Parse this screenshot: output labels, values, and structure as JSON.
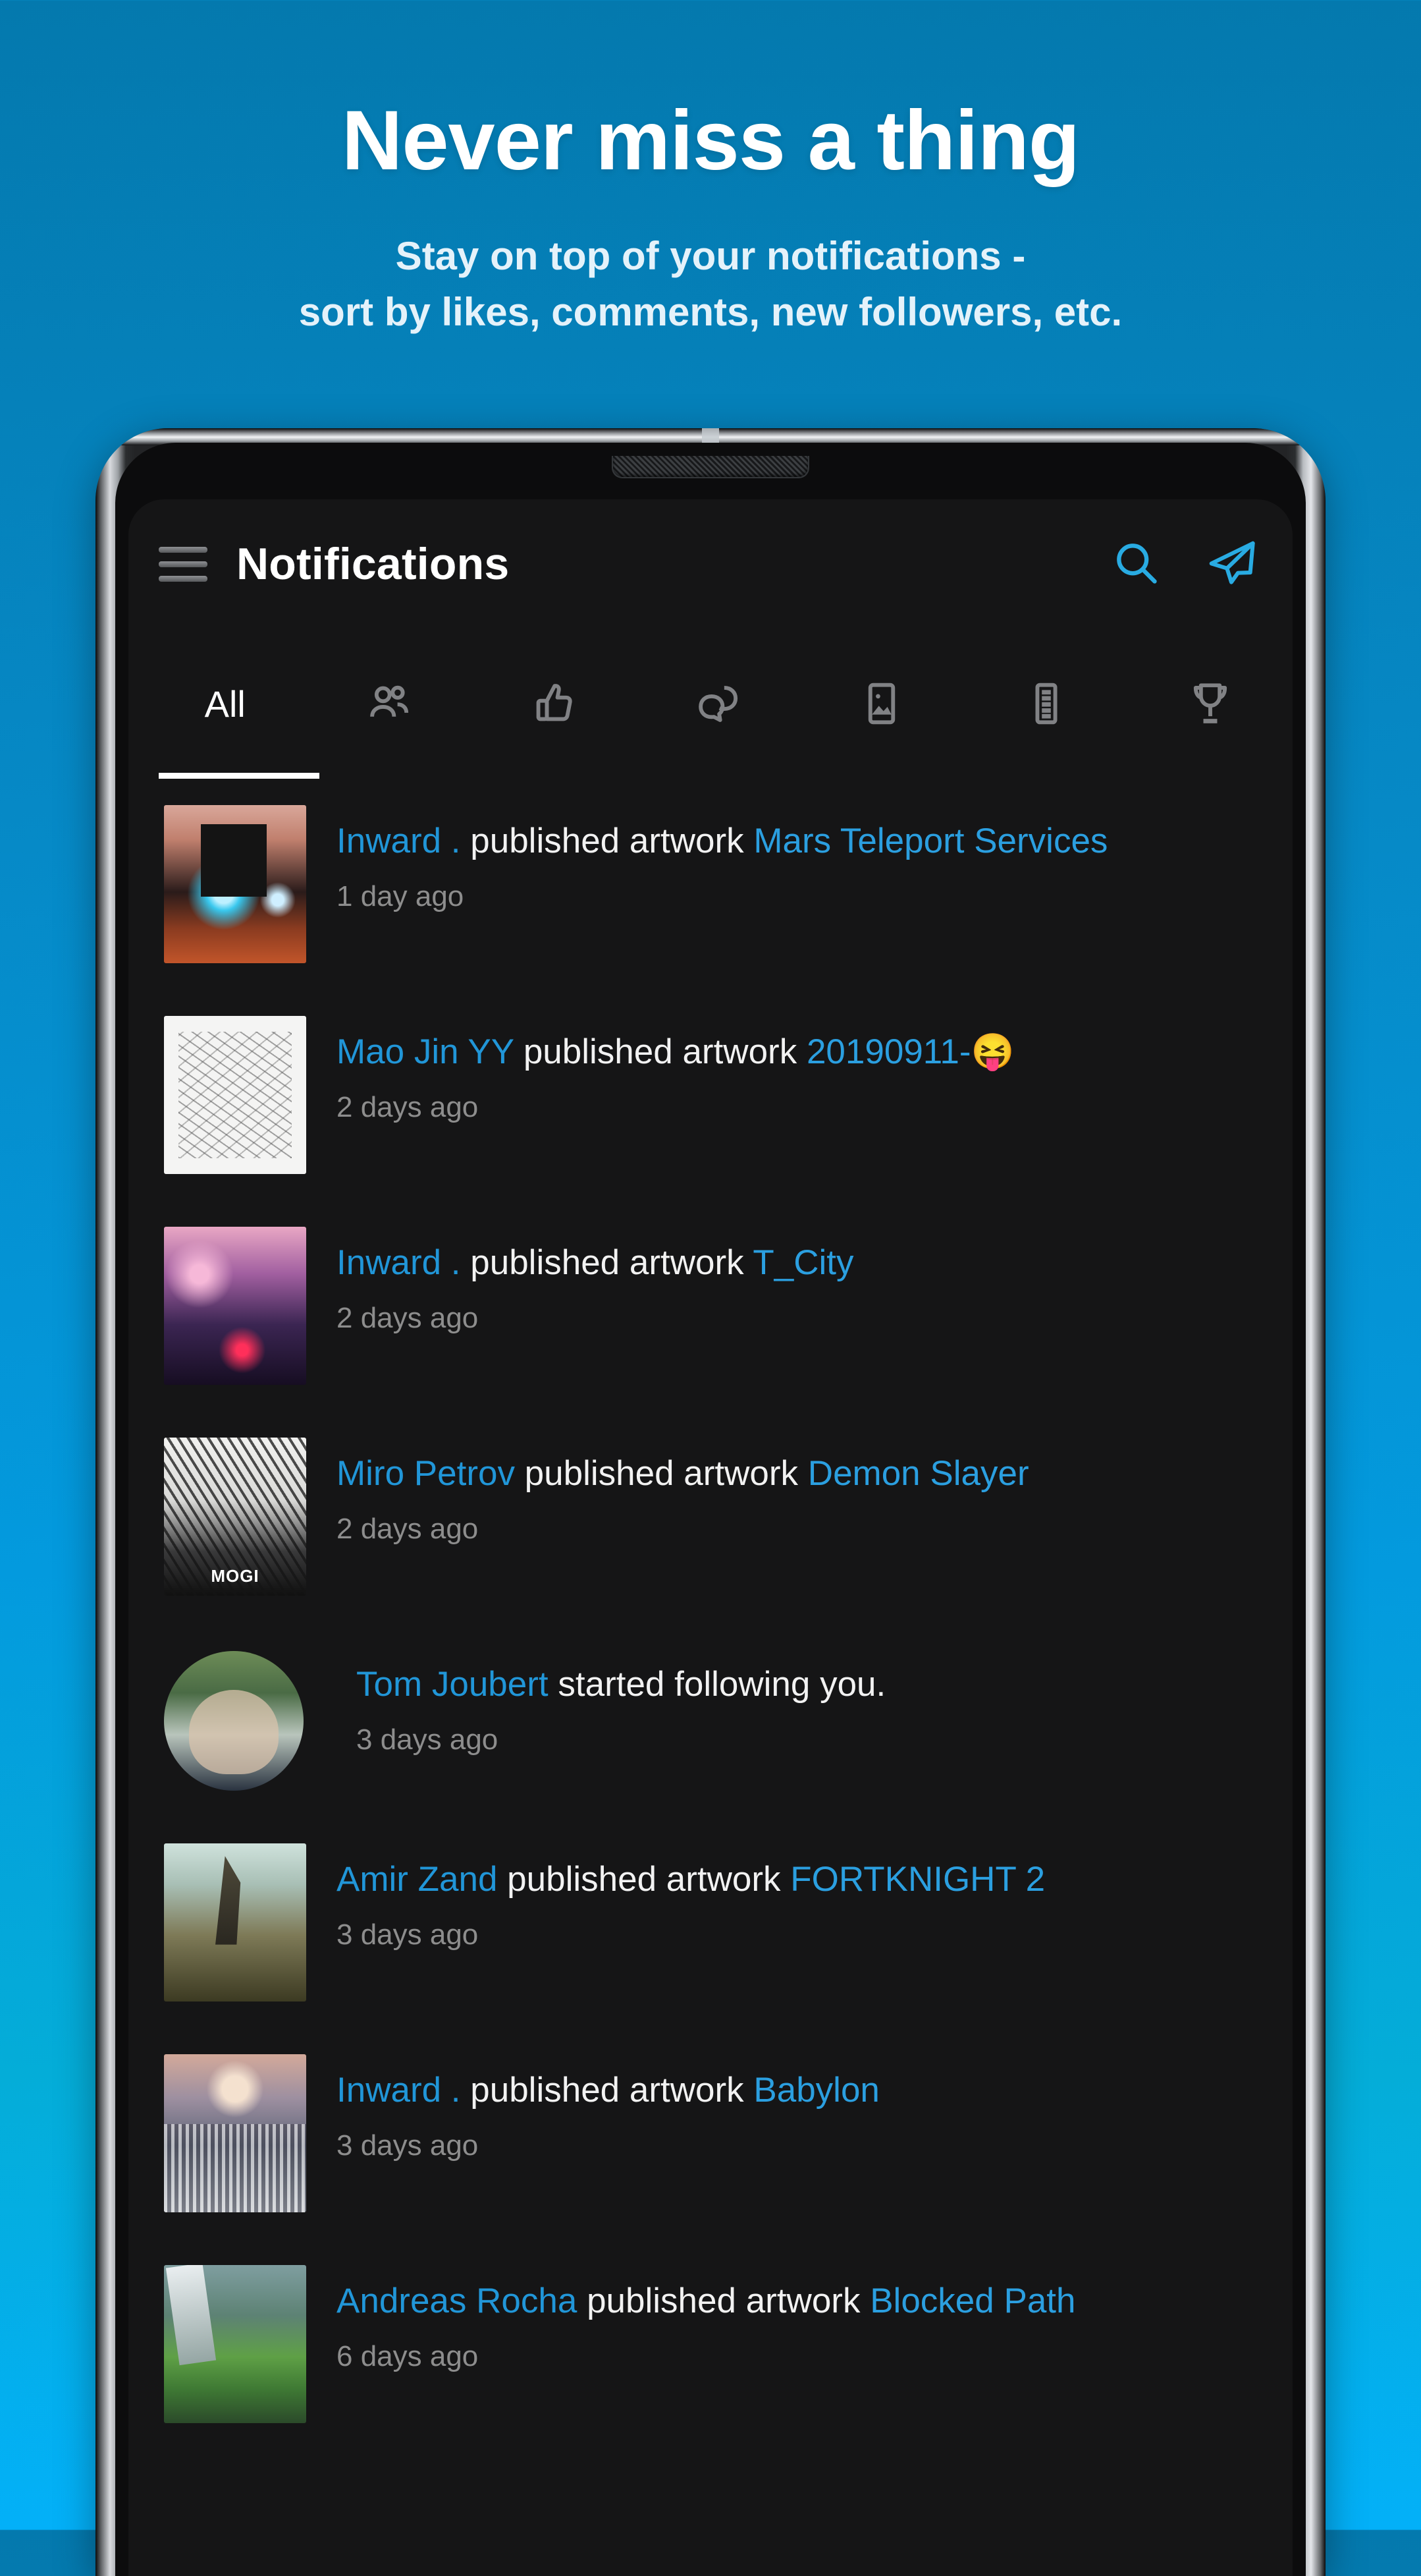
{
  "promo": {
    "title": "Never miss a thing",
    "subtitle_line1": "Stay on top of your notifications -",
    "subtitle_line2": "sort by likes, comments, new followers, etc."
  },
  "colors": {
    "bg_top": "#0479ae",
    "bg_bottom": "#03b0f8",
    "accent_cyan": "#29abe2",
    "link_blue": "#2196d8",
    "screen_bg": "#151516",
    "time_gray": "#8d8d8d"
  },
  "appbar": {
    "menu_icon": "hamburger-menu-icon",
    "title": "Notifications",
    "search_icon": "search-icon",
    "send_icon": "paper-plane-icon"
  },
  "tabs": [
    {
      "key": "all",
      "label": "All",
      "icon": null,
      "active": true
    },
    {
      "key": "followers",
      "label": "",
      "icon": "people-icon",
      "active": false
    },
    {
      "key": "likes",
      "label": "",
      "icon": "thumbs-up-icon",
      "active": false
    },
    {
      "key": "comments",
      "label": "",
      "icon": "comments-icon",
      "active": false
    },
    {
      "key": "images",
      "label": "",
      "icon": "image-icon",
      "active": false
    },
    {
      "key": "articles",
      "label": "",
      "icon": "article-icon",
      "active": false
    },
    {
      "key": "awards",
      "label": "",
      "icon": "trophy-icon",
      "active": false
    }
  ],
  "notifications": [
    {
      "user": "Inward .",
      "action": " published artwork ",
      "subject": "Mars Teleport Services",
      "time": "1 day ago",
      "thumb_shape": "rect",
      "thumb_class": "art1",
      "thumb_badge": ""
    },
    {
      "user": "Mao Jin  YY",
      "action": " published artwork ",
      "subject": "20190911-😝",
      "time": "2 days ago",
      "thumb_shape": "rect",
      "thumb_class": "art2",
      "thumb_badge": ""
    },
    {
      "user": "Inward .",
      "action": " published artwork ",
      "subject": "T_City",
      "time": "2 days ago",
      "thumb_shape": "rect",
      "thumb_class": "art3",
      "thumb_badge": ""
    },
    {
      "user": "Miro Petrov",
      "action": " published artwork ",
      "subject": "Demon Slayer",
      "time": "2 days ago",
      "thumb_shape": "rect",
      "thumb_class": "art4",
      "thumb_badge": "MOGI"
    },
    {
      "user": "Tom Joubert",
      "action": " started following you.",
      "subject": "",
      "time": "3 days ago",
      "thumb_shape": "round",
      "thumb_class": "art5",
      "thumb_badge": ""
    },
    {
      "user": "Amir Zand",
      "action": " published artwork ",
      "subject": "FORTKNIGHT 2",
      "time": "3 days ago",
      "thumb_shape": "rect",
      "thumb_class": "art6",
      "thumb_badge": ""
    },
    {
      "user": "Inward .",
      "action": " published artwork ",
      "subject": "Babylon",
      "time": "3 days ago",
      "thumb_shape": "rect",
      "thumb_class": "art7",
      "thumb_badge": ""
    },
    {
      "user": "Andreas Rocha",
      "action": " published artwork ",
      "subject": "Blocked Path",
      "time": "6 days ago",
      "thumb_shape": "rect",
      "thumb_class": "art8",
      "thumb_badge": ""
    }
  ]
}
